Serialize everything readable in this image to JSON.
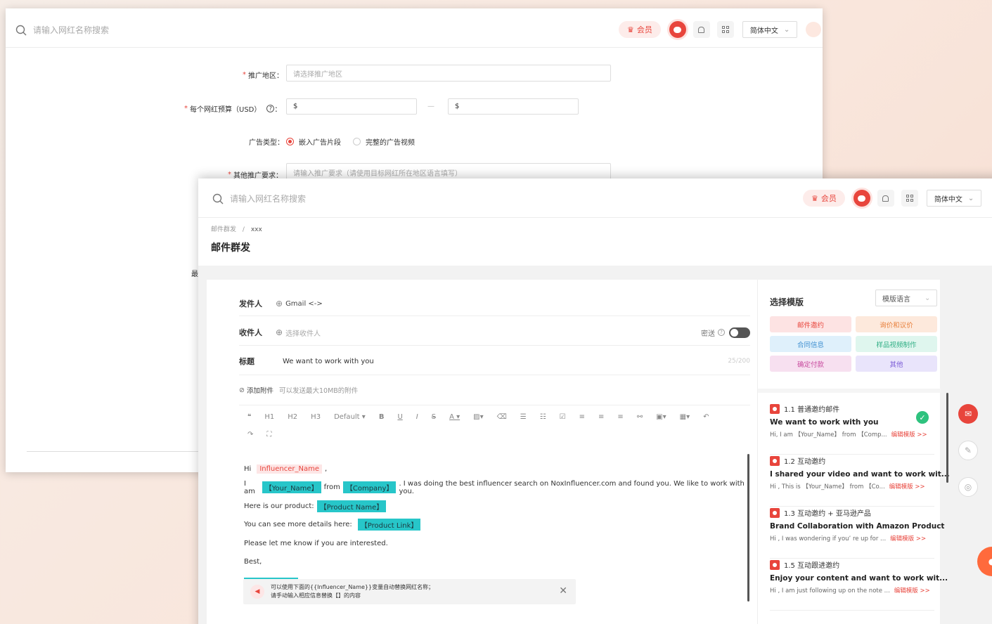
{
  "back_window": {
    "search_placeholder": "请输入网红名称搜索",
    "vip_label": "会员",
    "lang_label": "简体中文",
    "form": {
      "region_label": "推广地区：",
      "region_placeholder": "请选择推广地区",
      "budget_label": "每个网红预算（USD）",
      "budget_colon": "：",
      "budget_min": "$",
      "budget_dash": "—",
      "budget_max": "$",
      "adtype_label": "广告类型：",
      "adtype_opt1": "嵌入广告片段",
      "adtype_opt2": "完整的广告视频",
      "other_label": "其他推广要求：",
      "other_placeholder": "请输入推广要求（请使用目标网红所在地区语言填写）",
      "clipped_char": "最"
    }
  },
  "front_window": {
    "search_placeholder": "请输入网红名称搜索",
    "vip_label": "会员",
    "lang_label": "简体中文",
    "breadcrumb": [
      "邮件群发",
      "xxx"
    ],
    "breadcrumb_sep": "/",
    "page_title": "邮件群发",
    "sender_label": "发件人",
    "sender_value": "Gmail <->",
    "recipient_label": "收件人",
    "recipient_placeholder": "选择收件人",
    "bcc_label": "密送",
    "subject_label": "标题",
    "subject_value": "We want to work with you",
    "subject_count": "25/200",
    "attach_label": "添加附件",
    "attach_hint": "可以发送最大10MB的附件",
    "toolbar": [
      "H1",
      "H2",
      "H3",
      "Default ▾",
      "B",
      "U",
      "I",
      "S",
      "A ▾"
    ],
    "body": {
      "hi": "Hi",
      "influencer_tag": "Influencer_Name",
      "comma": ",",
      "i_am": "I am",
      "your_name_tag": "【Your_Name】",
      "from": "from",
      "company_tag": "【Company】",
      "line2_rest": ". I was doing the best influencer search on NoxInfluencer.com and found you. We like to work with you.",
      "product_text": "Here is our product:",
      "product_tag": "【Product Name】",
      "details_text": "You can see more details here:",
      "link_tag": "【Product Link】",
      "interested": "Please let me know if you are interested.",
      "best": "Best,"
    },
    "tip_line1": "可以使用下面的{{Influencer_Name}}变量自动替换网红名称；",
    "tip_line2": "请手动输入相应信息替换【】的内容",
    "template_title": "选择模版",
    "template_lang": "模版语言",
    "categories": [
      "邮件邀约",
      "询价和议价",
      "合同信息",
      "样品视频制作",
      "确定付款",
      "其他"
    ],
    "category_colors": {
      "c1_bg": "#fde3e3",
      "c1_fg": "#e8453c",
      "c2_bg": "#fde9dc",
      "c2_fg": "#e8803c",
      "c3_bg": "#dff0fb",
      "c3_fg": "#3f8fd0",
      "c4_bg": "#dff6ee",
      "c4_fg": "#2fae84",
      "c5_bg": "#f7e0f0",
      "c5_fg": "#c84a9e",
      "c6_bg": "#e9e4fb",
      "c6_fg": "#7a5ad6"
    },
    "templates": [
      {
        "head": "1.1 普通邀约邮件",
        "title": "We want to work with you",
        "desc": "Hi, I am 【Your_Name】 from 【Comp...",
        "edit": "编辑模版 >>"
      },
      {
        "head": "1.2 互动邀约",
        "title": "I shared your video and want to work wit...",
        "desc": "Hi , This is 【Your_Name】 from 【Co...",
        "edit": "编辑模版 >>"
      },
      {
        "head": "1.3 互动邀约 + 亚马逊产品",
        "title": "Brand Collaboration with Amazon Product",
        "desc": "Hi , I was wondering if you’ re up for ...",
        "edit": "编辑模版 >>"
      },
      {
        "head": "1.5 互动跟进邀约",
        "title": "Enjoy your content and want to work wit...",
        "desc": "Hi , I am just following up on the note ...",
        "edit": "编辑模版 >>"
      }
    ],
    "accent_color": "#e8453c"
  }
}
